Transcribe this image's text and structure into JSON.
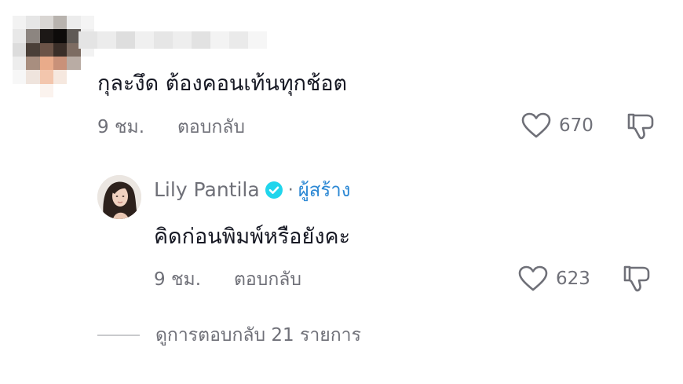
{
  "comment": {
    "text": "กุละงึด ต้องคอนเท้นทุกช้อต",
    "time": "9 ชม.",
    "reply_label": "ตอบกลับ",
    "likes": "670"
  },
  "reply": {
    "author": "Lily Pantila",
    "separator": "·",
    "creator_label": "ผู้สร้าง",
    "text": "คิดก่อนพิมพ์หรือยังคะ",
    "time": "9 ชม.",
    "reply_label": "ตอบกลับ",
    "likes": "623"
  },
  "view_replies": {
    "label": "ดูการตอบกลับ 21 รายการ"
  },
  "colors": {
    "text": "#161823",
    "secondary": "#6f7078",
    "creator_accent": "#2c88d4",
    "verified_badge": "#20d5ec"
  },
  "icons": [
    "heart-icon",
    "thumbs-down-icon",
    "verified-badge-icon"
  ]
}
